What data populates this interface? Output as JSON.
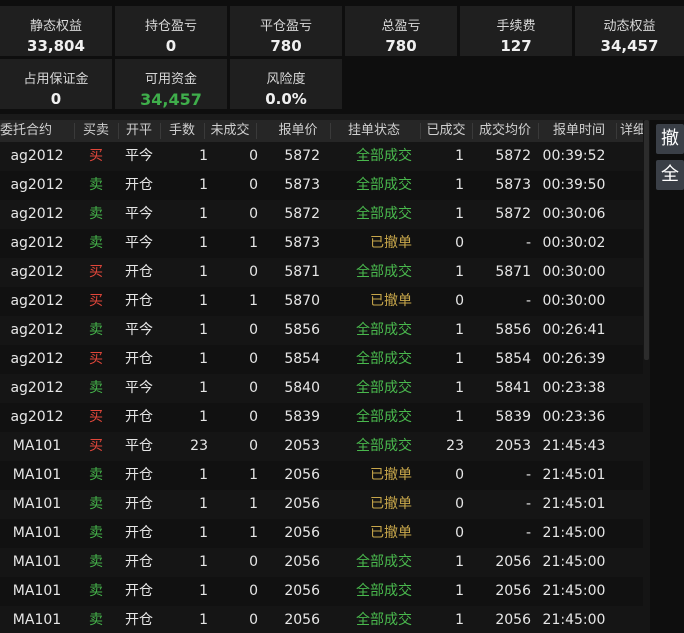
{
  "summary": {
    "items": [
      {
        "label": "静态权益",
        "value": "33,804"
      },
      {
        "label": "持仓盈亏",
        "value": "0"
      },
      {
        "label": "平仓盈亏",
        "value": "780"
      },
      {
        "label": "总盈亏",
        "value": "780"
      },
      {
        "label": "手续费",
        "value": "127"
      },
      {
        "label": "动态权益",
        "value": "34,457"
      },
      {
        "label": "占用保证金",
        "value": "0"
      },
      {
        "label": "可用资金",
        "value": "34,457"
      },
      {
        "label": "风险度",
        "value": "0.0%"
      }
    ],
    "available_color": "#3fae4b"
  },
  "table": {
    "headers": [
      "委托合约",
      "买卖",
      "开平",
      "手数",
      "未成交",
      "报单价",
      "挂单状态",
      "已成交",
      "成交均价",
      "报单时间",
      "详细"
    ],
    "rows": [
      {
        "symbol": "ag2012",
        "dir": "买",
        "oc": "平今",
        "qty": "1",
        "unfilled": "0",
        "price": "5872",
        "status": "全部成交",
        "filled": "1",
        "avg": "5872",
        "time": "00:39:52"
      },
      {
        "symbol": "ag2012",
        "dir": "卖",
        "oc": "开仓",
        "qty": "1",
        "unfilled": "0",
        "price": "5873",
        "status": "全部成交",
        "filled": "1",
        "avg": "5873",
        "time": "00:39:50"
      },
      {
        "symbol": "ag2012",
        "dir": "卖",
        "oc": "平今",
        "qty": "1",
        "unfilled": "0",
        "price": "5872",
        "status": "全部成交",
        "filled": "1",
        "avg": "5872",
        "time": "00:30:06"
      },
      {
        "symbol": "ag2012",
        "dir": "卖",
        "oc": "平今",
        "qty": "1",
        "unfilled": "1",
        "price": "5873",
        "status": "已撤单",
        "filled": "0",
        "avg": "-",
        "time": "00:30:02"
      },
      {
        "symbol": "ag2012",
        "dir": "买",
        "oc": "开仓",
        "qty": "1",
        "unfilled": "0",
        "price": "5871",
        "status": "全部成交",
        "filled": "1",
        "avg": "5871",
        "time": "00:30:00"
      },
      {
        "symbol": "ag2012",
        "dir": "买",
        "oc": "开仓",
        "qty": "1",
        "unfilled": "1",
        "price": "5870",
        "status": "已撤单",
        "filled": "0",
        "avg": "-",
        "time": "00:30:00"
      },
      {
        "symbol": "ag2012",
        "dir": "卖",
        "oc": "平今",
        "qty": "1",
        "unfilled": "0",
        "price": "5856",
        "status": "全部成交",
        "filled": "1",
        "avg": "5856",
        "time": "00:26:41"
      },
      {
        "symbol": "ag2012",
        "dir": "买",
        "oc": "开仓",
        "qty": "1",
        "unfilled": "0",
        "price": "5854",
        "status": "全部成交",
        "filled": "1",
        "avg": "5854",
        "time": "00:26:39"
      },
      {
        "symbol": "ag2012",
        "dir": "卖",
        "oc": "平今",
        "qty": "1",
        "unfilled": "0",
        "price": "5840",
        "status": "全部成交",
        "filled": "1",
        "avg": "5841",
        "time": "00:23:38"
      },
      {
        "symbol": "ag2012",
        "dir": "买",
        "oc": "开仓",
        "qty": "1",
        "unfilled": "0",
        "price": "5839",
        "status": "全部成交",
        "filled": "1",
        "avg": "5839",
        "time": "00:23:36"
      },
      {
        "symbol": "MA101",
        "dir": "买",
        "oc": "平仓",
        "qty": "23",
        "unfilled": "0",
        "price": "2053",
        "status": "全部成交",
        "filled": "23",
        "avg": "2053",
        "time": "21:45:43"
      },
      {
        "symbol": "MA101",
        "dir": "卖",
        "oc": "开仓",
        "qty": "1",
        "unfilled": "1",
        "price": "2056",
        "status": "已撤单",
        "filled": "0",
        "avg": "-",
        "time": "21:45:01"
      },
      {
        "symbol": "MA101",
        "dir": "卖",
        "oc": "开仓",
        "qty": "1",
        "unfilled": "1",
        "price": "2056",
        "status": "已撤单",
        "filled": "0",
        "avg": "-",
        "time": "21:45:01"
      },
      {
        "symbol": "MA101",
        "dir": "卖",
        "oc": "开仓",
        "qty": "1",
        "unfilled": "1",
        "price": "2056",
        "status": "已撤单",
        "filled": "0",
        "avg": "-",
        "time": "21:45:00"
      },
      {
        "symbol": "MA101",
        "dir": "卖",
        "oc": "开仓",
        "qty": "1",
        "unfilled": "0",
        "price": "2056",
        "status": "全部成交",
        "filled": "1",
        "avg": "2056",
        "time": "21:45:00"
      },
      {
        "symbol": "MA101",
        "dir": "卖",
        "oc": "开仓",
        "qty": "1",
        "unfilled": "0",
        "price": "2056",
        "status": "全部成交",
        "filled": "1",
        "avg": "2056",
        "time": "21:45:00"
      },
      {
        "symbol": "MA101",
        "dir": "卖",
        "oc": "开仓",
        "qty": "1",
        "unfilled": "0",
        "price": "2056",
        "status": "全部成交",
        "filled": "1",
        "avg": "2056",
        "time": "21:45:00"
      }
    ]
  },
  "side_buttons": {
    "cancel": "撤",
    "all": "全"
  },
  "colors": {
    "buy": "#e0463a",
    "sell": "#45b34a",
    "filled": "#49b84d",
    "cancelled": "#c7a64a"
  }
}
